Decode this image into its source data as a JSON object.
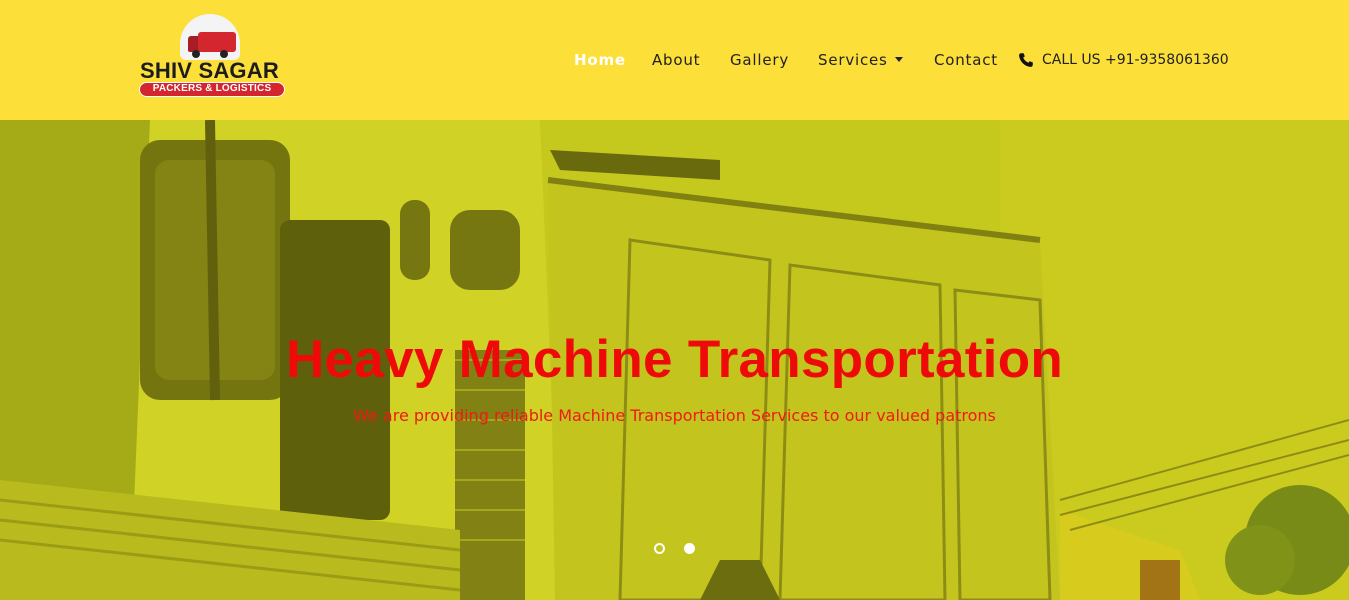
{
  "logo": {
    "name": "SHIV SAGAR",
    "tagline": "PACKERS & LOGISTICS"
  },
  "nav": {
    "items": [
      {
        "label": "Home",
        "active": true
      },
      {
        "label": "About",
        "active": false
      },
      {
        "label": "Gallery",
        "active": false
      },
      {
        "label": "Services",
        "active": false,
        "dropdown": true
      },
      {
        "label": "Contact",
        "active": false
      }
    ],
    "call": {
      "label": "CALL US +91-9358061360",
      "icon": "phone-icon"
    }
  },
  "hero": {
    "title": "Heavy Machine Transportation",
    "subtitle": "We are providing reliable Machine Transportation Services to our valued patrons",
    "slides": 2,
    "active_slide": 2
  },
  "colors": {
    "header_bg": "#fddf3a",
    "accent_red": "#ef0a0a",
    "nav_text": "#212121",
    "nav_active": "#ffffff"
  }
}
